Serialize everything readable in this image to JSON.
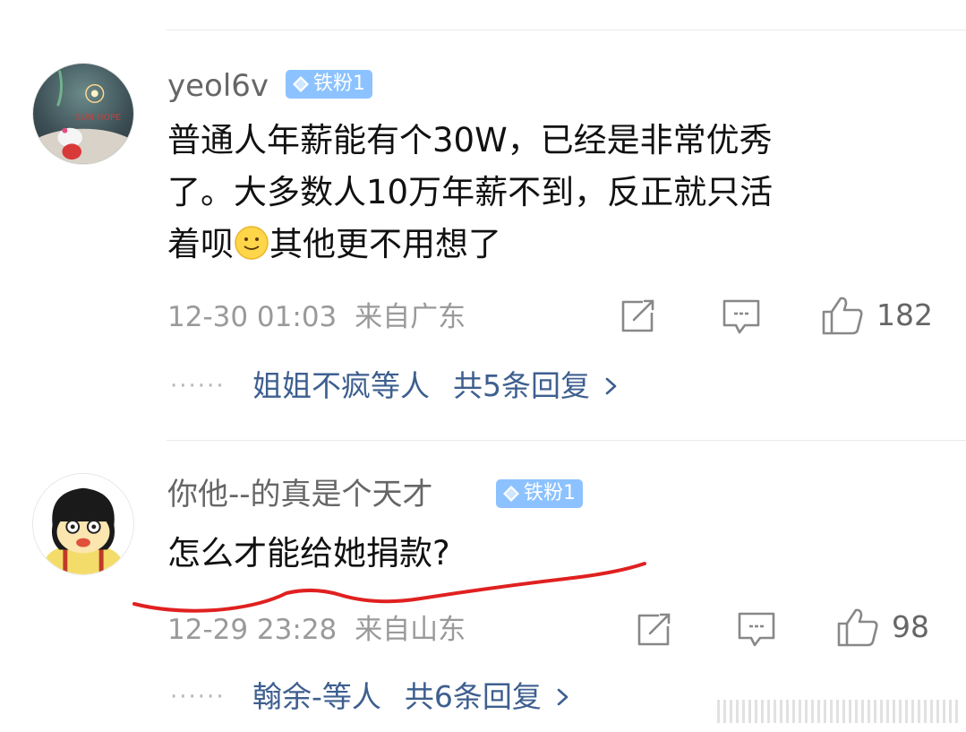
{
  "comments": [
    {
      "username": "yeol6v",
      "badge": "铁粉1",
      "text_lines": [
        "普通人年薪能有个30W，已经是非常优秀",
        "了。大多数人10万年薪不到，反正就只活"
      ],
      "text_line3_before": "着呗",
      "text_line3_after": "其他更不用想了",
      "emoji": "smile-emoji",
      "time": "12-30 01:03",
      "location": "来自广东",
      "likes": "182",
      "reply_users": "姐姐不疯等人",
      "reply_count": "共5条回复",
      "avatar_caption": "SUN HOPE"
    },
    {
      "username": "你他--的真是个天才",
      "badge": "铁粉1",
      "text": "怎么才能给她捐款?",
      "time": "12-29 23:28",
      "location": "来自山东",
      "likes": "98",
      "reply_users": "翰余-等人",
      "reply_count": "共6条回复"
    }
  ],
  "icons": {
    "share": "share-icon",
    "comment": "comment-icon",
    "like": "thumbs-up-icon",
    "chevron": "chevron-right-icon"
  },
  "colors": {
    "badge": "#8cc2ff",
    "reply_link": "#3e5f8f",
    "meta": "#9a9a9a",
    "annotation": "#e02020"
  }
}
